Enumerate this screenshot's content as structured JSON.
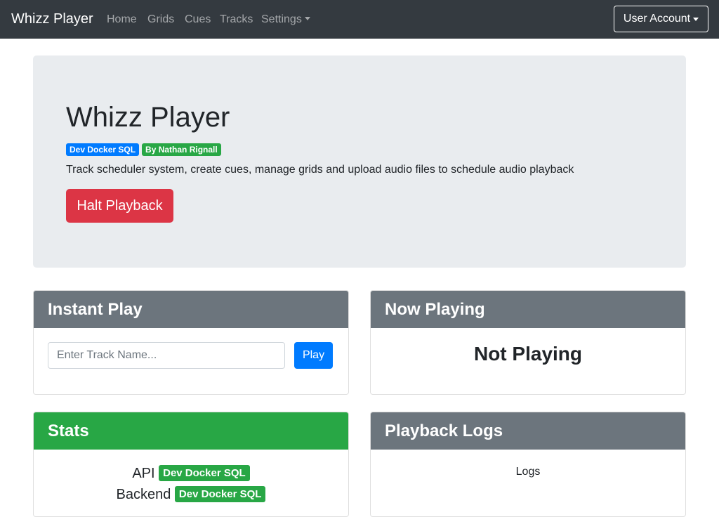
{
  "navbar": {
    "brand": "Whizz Player",
    "links": [
      "Home",
      "Grids",
      "Cues",
      "Tracks",
      "Settings"
    ],
    "account_label": "User Account"
  },
  "hero": {
    "title": "Whizz Player",
    "badges": [
      "Dev Docker SQL",
      "By Nathan Rignall"
    ],
    "description": "Track scheduler system, create cues, manage grids and upload audio files to schedule audio playback",
    "halt_label": "Halt Playback"
  },
  "instant_play": {
    "title": "Instant Play",
    "placeholder": "Enter Track Name...",
    "play_label": "Play"
  },
  "now_playing": {
    "title": "Now Playing",
    "status": "Not Playing"
  },
  "stats": {
    "title": "Stats",
    "rows": [
      {
        "label": "API",
        "value": "Dev Docker SQL"
      },
      {
        "label": "Backend",
        "value": "Dev Docker SQL"
      }
    ]
  },
  "playback_logs": {
    "title": "Playback Logs",
    "content": "Logs"
  },
  "colors": {
    "navbar": "#343a40",
    "primary": "#007bff",
    "success": "#28a745",
    "danger": "#dc3545",
    "secondary": "#6c757d"
  }
}
